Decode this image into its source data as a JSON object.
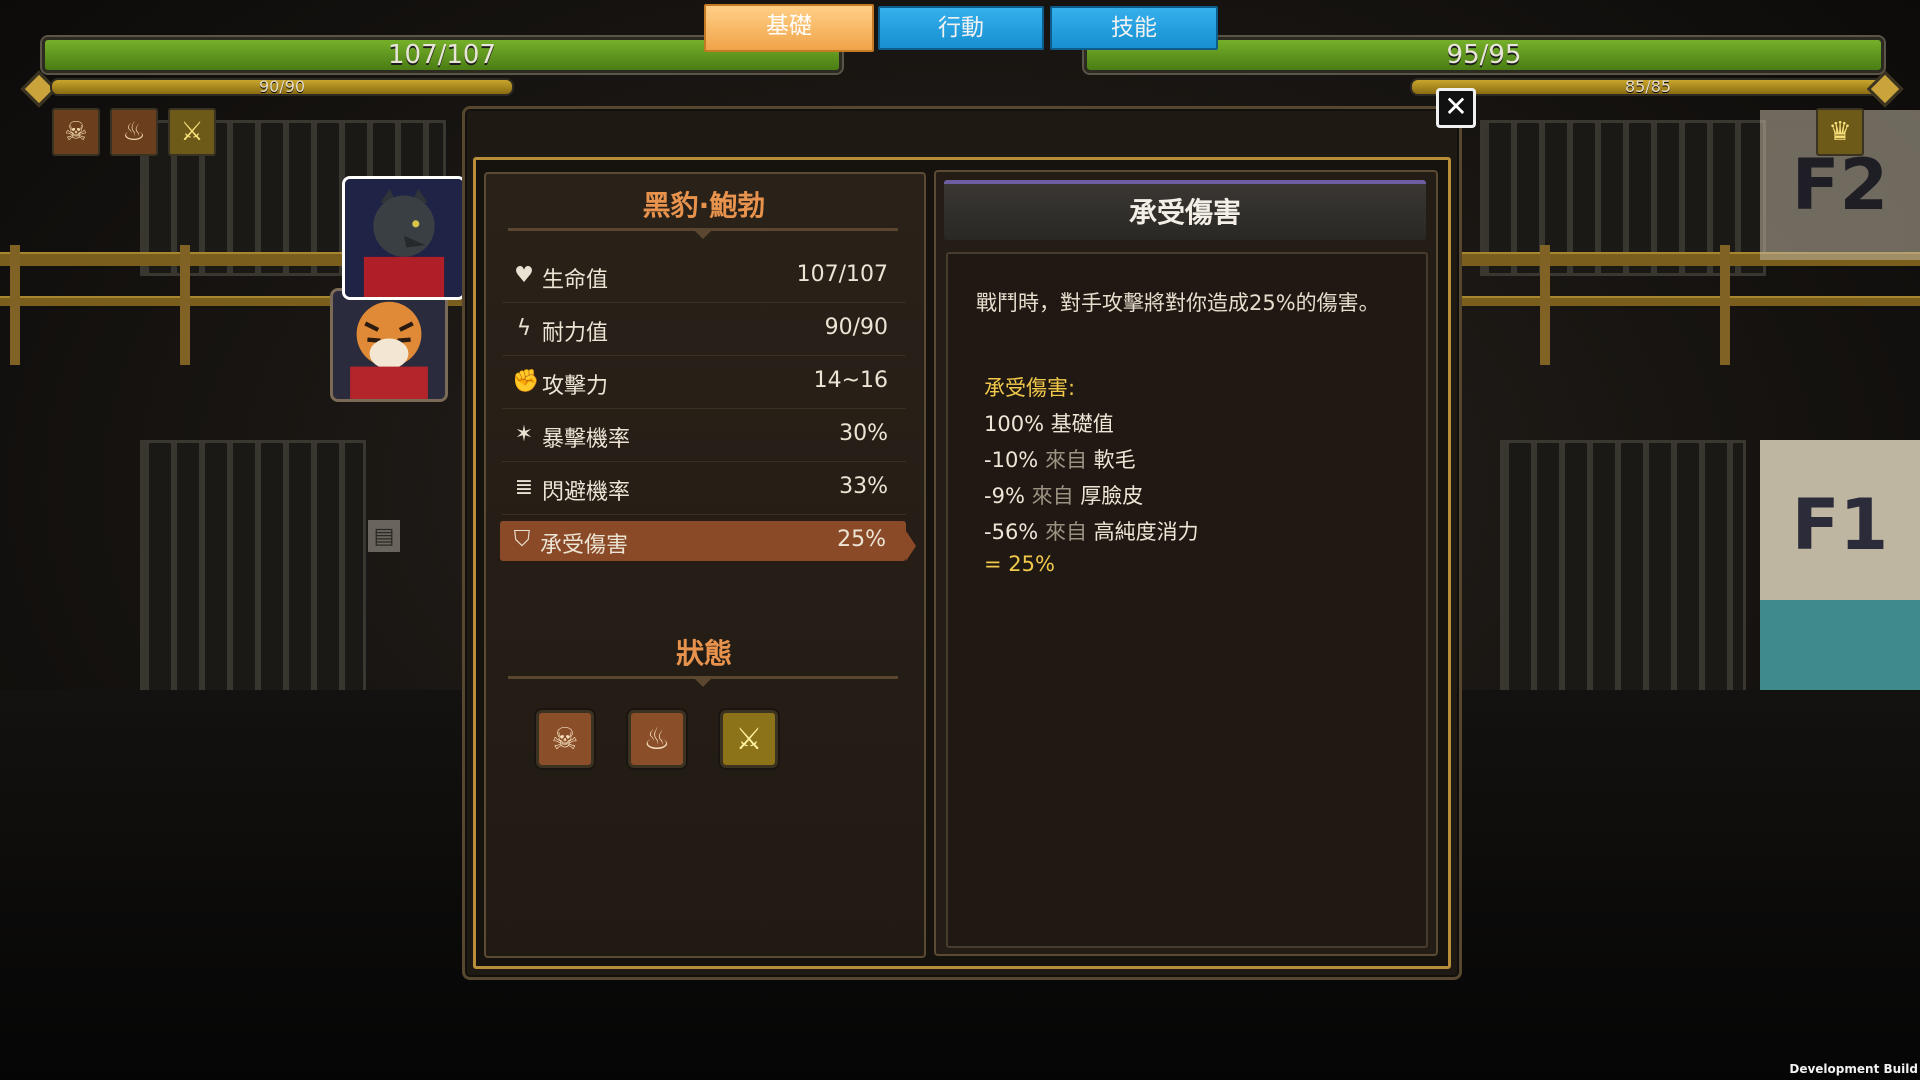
{
  "hud": {
    "player": {
      "hp": "107/107",
      "hp_fraction": 1.0,
      "stamina": "90/90",
      "stamina_fraction": 1.0
    },
    "enemy": {
      "hp": "95/95",
      "hp_fraction": 1.0,
      "stamina": "85/85",
      "stamina_fraction": 1.0
    },
    "player_status_icons": [
      "demon-mask-icon",
      "flame-totem-icon",
      "sword-emblem-icon"
    ],
    "enemy_status_icons": [
      "tiger-head-icon"
    ]
  },
  "tabs": [
    {
      "label": "基礎",
      "active": true
    },
    {
      "label": "行動",
      "active": false
    },
    {
      "label": "技能",
      "active": false
    }
  ],
  "character": {
    "name": "黑豹·鮑勃",
    "stats": [
      {
        "icon": "heart-icon",
        "glyph": "♥",
        "label": "生命值",
        "value": "107/107"
      },
      {
        "icon": "lightning-icon",
        "glyph": "ϟ",
        "label": "耐力值",
        "value": "90/90"
      },
      {
        "icon": "fist-icon",
        "glyph": "✊",
        "label": "攻擊力",
        "value": "14~16"
      },
      {
        "icon": "crit-icon",
        "glyph": "✶",
        "label": "暴擊機率",
        "value": "30%"
      },
      {
        "icon": "dodge-icon",
        "glyph": "≣",
        "label": "閃避機率",
        "value": "33%"
      },
      {
        "icon": "shield-icon",
        "glyph": "⛉",
        "label": "承受傷害",
        "value": "25%"
      }
    ],
    "selected_stat_index": 5
  },
  "status_section": {
    "title": "狀態",
    "icons": [
      "demon-mask-icon",
      "flame-totem-icon",
      "sword-emblem-icon"
    ]
  },
  "detail": {
    "title": "承受傷害",
    "description": "戰鬥時，對手攻擊將對你造成25%的傷害。",
    "breakdown_title": "承受傷害:",
    "breakdown": [
      {
        "value": "100%",
        "label": "基礎值"
      },
      {
        "value": "-10%",
        "from": "來自",
        "source": "軟毛"
      },
      {
        "value": "-9%",
        "from": "來自",
        "source": "厚臉皮"
      },
      {
        "value": "-56%",
        "from": "來自",
        "source": "高純度消力"
      }
    ],
    "result": "= 25%"
  },
  "scene": {
    "sign_f2": "F2",
    "sign_f1": "F1"
  },
  "footer": "Development Build",
  "colors": {
    "hp": "#5e9a1e",
    "stamina": "#b8921f",
    "accent": "#e8934d",
    "gold_text": "#f1c84a",
    "tab_blue": "#1f9ee0",
    "tab_active": "#f5b865"
  }
}
